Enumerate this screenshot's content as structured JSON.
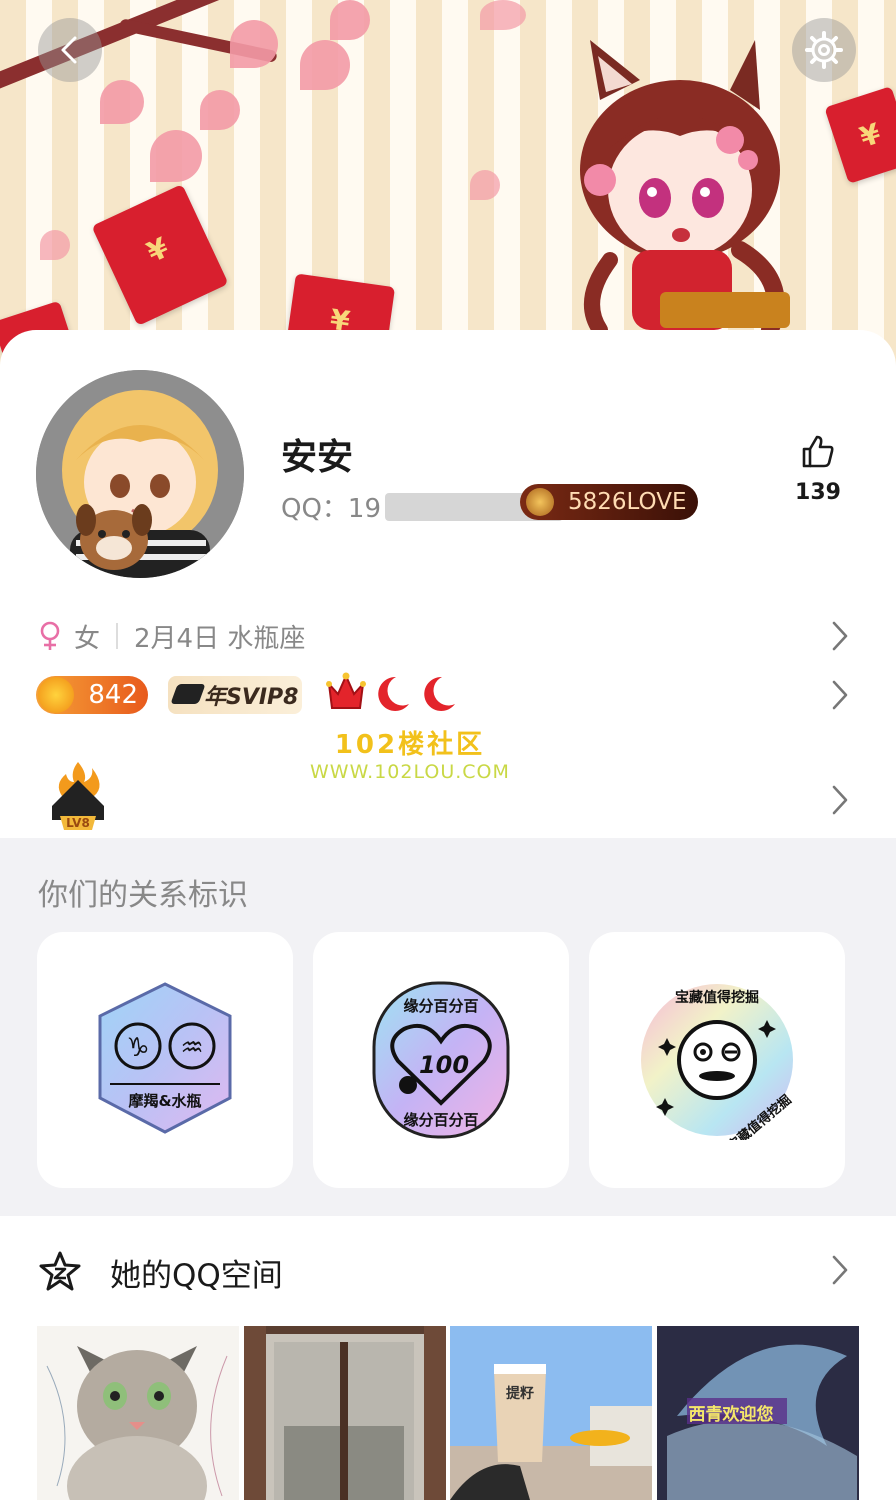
{
  "header": {
    "back_icon": "chevron-left-icon",
    "settings_icon": "gear-icon"
  },
  "profile": {
    "nickname": "安安",
    "qq_prefix": "QQ：19",
    "love_badge": "5826LOVE",
    "like_count": "139",
    "like_icon": "thumbs-up-icon",
    "gender_icon": "female-icon",
    "gender": "女",
    "birthday_sign": "2月4日 水瓶座",
    "coin_count": "842",
    "svip_label": "年SVIP8",
    "level_label": "LV8"
  },
  "watermark": {
    "line1": "102楼社区",
    "line2": "WWW.102LOU.COM"
  },
  "relationship": {
    "title": "你们的关系标识",
    "badges": [
      {
        "label": "摩羯&水瓶"
      },
      {
        "label_top": "缘分百分百",
        "label_center": "100",
        "label_bottom": "缘分百分百"
      },
      {
        "label_top": "宝藏值得挖掘",
        "label_side": "宝藏值得挖掘"
      }
    ]
  },
  "qzone": {
    "label": "她的QQ空间",
    "photos": [
      {
        "caption": ""
      },
      {
        "caption": ""
      },
      {
        "caption": "提籽"
      },
      {
        "caption": "西青欢迎您"
      }
    ]
  },
  "colors": {
    "accent_red": "#d81f2e",
    "coin_orange": "#f08b12",
    "female_pink": "#e86fa6",
    "section_bg": "#f2f2f5"
  }
}
